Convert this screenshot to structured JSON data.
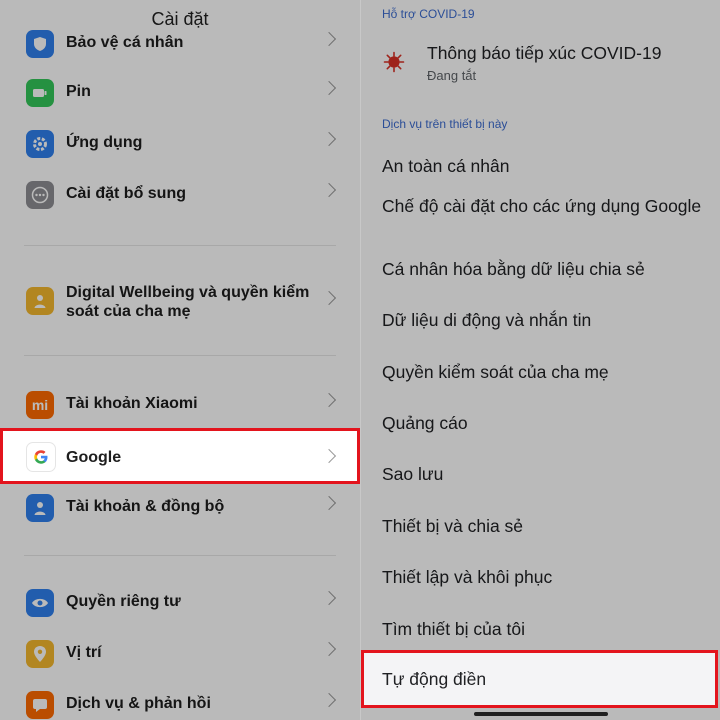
{
  "left": {
    "title": "Cài đặt",
    "items": [
      {
        "label": "Bảo vệ cá nhân",
        "icon": "shield-icon",
        "color": "#2f80ed"
      },
      {
        "label": "Pin",
        "icon": "battery-icon",
        "color": "#34c759"
      },
      {
        "label": "Ứng dụng",
        "icon": "gear-icon",
        "color": "#2f80ed"
      },
      {
        "label": "Cài đặt bổ sung",
        "icon": "more-dots-icon",
        "color": "#8e8e93"
      },
      {
        "label": "Digital Wellbeing và quyền kiểm soát của cha mẹ",
        "icon": "wellbeing-person-icon",
        "color": "#f5b82e"
      },
      {
        "label": "Tài khoản Xiaomi",
        "icon": "xiaomi-mi-icon",
        "color": "#ff6a00"
      },
      {
        "label": "Google",
        "icon": "google-g-icon",
        "color": "#ffffff"
      },
      {
        "label": "Tài khoản & đồng bộ",
        "icon": "account-person-icon",
        "color": "#2f80ed"
      },
      {
        "label": "Quyền riêng tư",
        "icon": "eye-icon",
        "color": "#2f80ed"
      },
      {
        "label": "Vị trí",
        "icon": "location-pin-icon",
        "color": "#f5b82e"
      },
      {
        "label": "Dịch vụ & phản hồi",
        "icon": "feedback-icon",
        "color": "#ff6a00"
      }
    ],
    "xiaomi_glyph": "mi",
    "highlight_color": "#e3141d"
  },
  "right": {
    "section_covid": "Hỗ trợ COVID-19",
    "covid_title": "Thông báo tiếp xúc COVID-19",
    "covid_status": "Đang tắt",
    "section_device": "Dịch vụ trên thiết bị này",
    "items": [
      "An toàn cá nhân",
      "Chế độ cài đặt cho các ứng dụng Google",
      "Cá nhân hóa bằng dữ liệu chia sẻ",
      "Dữ liệu di động và nhắn tin",
      "Quyền kiểm soát của cha mẹ",
      "Quảng cáo",
      "Sao lưu",
      "Thiết bị và chia sẻ",
      "Thiết lập và khôi phục",
      "Tìm thiết bị của tôi",
      "Tự động điền"
    ],
    "accent_color": "#3c6bd0",
    "virus_color": "#d93025"
  }
}
